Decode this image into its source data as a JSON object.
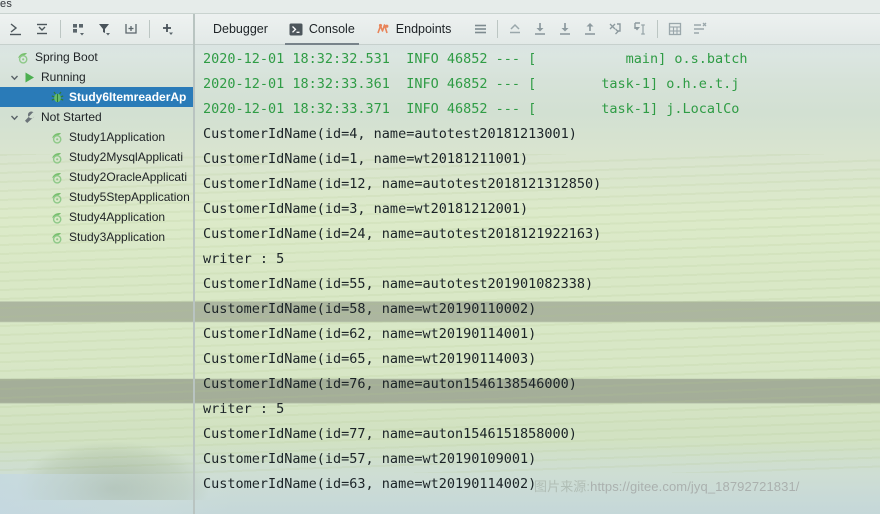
{
  "top_strip": {
    "clipped_tab_label": "es"
  },
  "left_panel": {
    "toolbar": [
      {
        "name": "expand-all-icon",
        "label": "Expand All"
      },
      {
        "name": "collapse-all-icon",
        "label": "Collapse All"
      },
      {
        "name": "group-by-icon",
        "label": "Group By"
      },
      {
        "name": "filter-icon",
        "label": "Filter"
      },
      {
        "name": "add-frame-icon",
        "label": "Add Configuration"
      },
      {
        "name": "add-icon",
        "label": "Add"
      }
    ],
    "tree": [
      {
        "label": "Spring Boot",
        "icon": "spring-leaf-icon",
        "depth": 0,
        "twisty": "",
        "selected": false
      },
      {
        "label": "Running",
        "icon": "run-triangle-icon",
        "depth": 1,
        "twisty": "⌄",
        "selected": false
      },
      {
        "label": "Study6ItemreaderAp",
        "icon": "debug-bug-icon",
        "depth": 2,
        "twisty": "",
        "selected": true
      },
      {
        "label": "Not Started",
        "icon": "wrench-icon",
        "depth": 1,
        "twisty": "⌄",
        "selected": false
      },
      {
        "label": "Study1Application",
        "icon": "spring-leaf-icon",
        "depth": 2,
        "twisty": "",
        "selected": false
      },
      {
        "label": "Study2MysqlApplicati",
        "icon": "spring-leaf-icon",
        "depth": 2,
        "twisty": "",
        "selected": false
      },
      {
        "label": "Study2OracleApplicati",
        "icon": "spring-leaf-icon",
        "depth": 2,
        "twisty": "",
        "selected": false
      },
      {
        "label": "Study5StepApplication",
        "icon": "spring-leaf-icon",
        "depth": 2,
        "twisty": "",
        "selected": false
      },
      {
        "label": "Study4Application",
        "icon": "spring-leaf-icon",
        "depth": 2,
        "twisty": "",
        "selected": false
      },
      {
        "label": "Study3Application",
        "icon": "spring-leaf-icon",
        "depth": 2,
        "twisty": "",
        "selected": false
      }
    ]
  },
  "right_panel": {
    "tabs": [
      {
        "label": "Debugger",
        "icon": "",
        "active": false
      },
      {
        "label": "Console",
        "icon": "console-icon",
        "active": true
      },
      {
        "label": "Endpoints",
        "icon": "endpoints-icon",
        "active": false
      }
    ],
    "toolbar_icons": [
      {
        "name": "menu-hamburger-icon",
        "label": "Menu"
      },
      {
        "name": "show-execution-point-icon",
        "label": "Show Execution Point"
      },
      {
        "name": "step-over-icon",
        "label": "Step Over"
      },
      {
        "name": "step-into-icon",
        "label": "Step Into"
      },
      {
        "name": "step-out-icon",
        "label": "Step Out"
      },
      {
        "name": "force-step-into-icon",
        "label": "Force Step Into"
      },
      {
        "name": "run-to-cursor-icon",
        "label": "Run to Cursor"
      },
      {
        "name": "evaluate-expression-icon",
        "label": "Evaluate Expression"
      },
      {
        "name": "settings-lines-icon",
        "label": "Layout Settings"
      }
    ],
    "console_lines": [
      {
        "type": "info",
        "text": "2020-12-01 18:32:32.531  INFO 46852 --- [           main] o.s.batch"
      },
      {
        "type": "info",
        "text": "2020-12-01 18:32:33.361  INFO 46852 --- [        task-1] o.h.e.t.j"
      },
      {
        "type": "info",
        "text": "2020-12-01 18:32:33.371  INFO 46852 --- [        task-1] j.LocalCo"
      },
      {
        "type": "out",
        "text": "CustomerIdName(id=4, name=autotest20181213001)"
      },
      {
        "type": "out",
        "text": "CustomerIdName(id=1, name=wt20181211001)"
      },
      {
        "type": "out",
        "text": "CustomerIdName(id=12, name=autotest2018121312850)"
      },
      {
        "type": "out",
        "text": "CustomerIdName(id=3, name=wt20181212001)"
      },
      {
        "type": "out",
        "text": "CustomerIdName(id=24, name=autotest2018121922163)"
      },
      {
        "type": "out",
        "text": "writer : 5"
      },
      {
        "type": "out",
        "text": "CustomerIdName(id=55, name=autotest201901082338)"
      },
      {
        "type": "out",
        "text": "CustomerIdName(id=58, name=wt20190110002)"
      },
      {
        "type": "out",
        "text": "CustomerIdName(id=62, name=wt20190114001)"
      },
      {
        "type": "out",
        "text": "CustomerIdName(id=65, name=wt20190114003)"
      },
      {
        "type": "out",
        "text": "CustomerIdName(id=76, name=auton1546138546000)"
      },
      {
        "type": "out",
        "text": "writer : 5"
      },
      {
        "type": "out",
        "text": "CustomerIdName(id=77, name=auton1546151858000)"
      },
      {
        "type": "out",
        "text": "CustomerIdName(id=57, name=wt20190109001)"
      },
      {
        "type": "out",
        "text": "CustomerIdName(id=63, name=wt20190114002)"
      }
    ]
  },
  "watermark": {
    "prefix": "图片来源:",
    "url": "https://gitee.com/jyq_18792721831/"
  },
  "colors": {
    "selection": "#2a7bb8",
    "log_info": "#2f9c45",
    "log_out": "#1b2327",
    "toolbar_bg": "#e7edeb"
  }
}
